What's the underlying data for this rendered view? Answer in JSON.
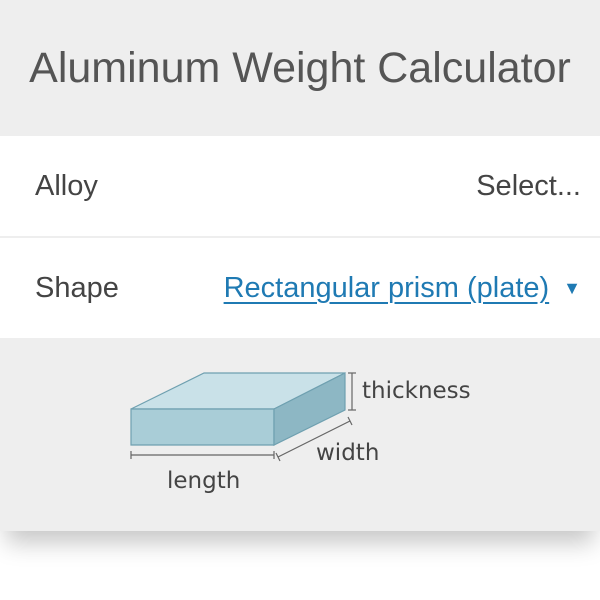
{
  "header": {
    "title": "Aluminum Weight Calculator"
  },
  "alloy": {
    "label": "Alloy",
    "placeholder": "Select..."
  },
  "shape": {
    "label": "Shape",
    "selected": "Rectangular prism (plate)"
  },
  "diagram": {
    "labels": {
      "thickness": "thickness",
      "width": "width",
      "length": "length"
    },
    "colors": {
      "front": "#a9cdd7",
      "top": "#c9e1e8",
      "side": "#8db7c4",
      "edge": "#6fa0b0"
    }
  }
}
